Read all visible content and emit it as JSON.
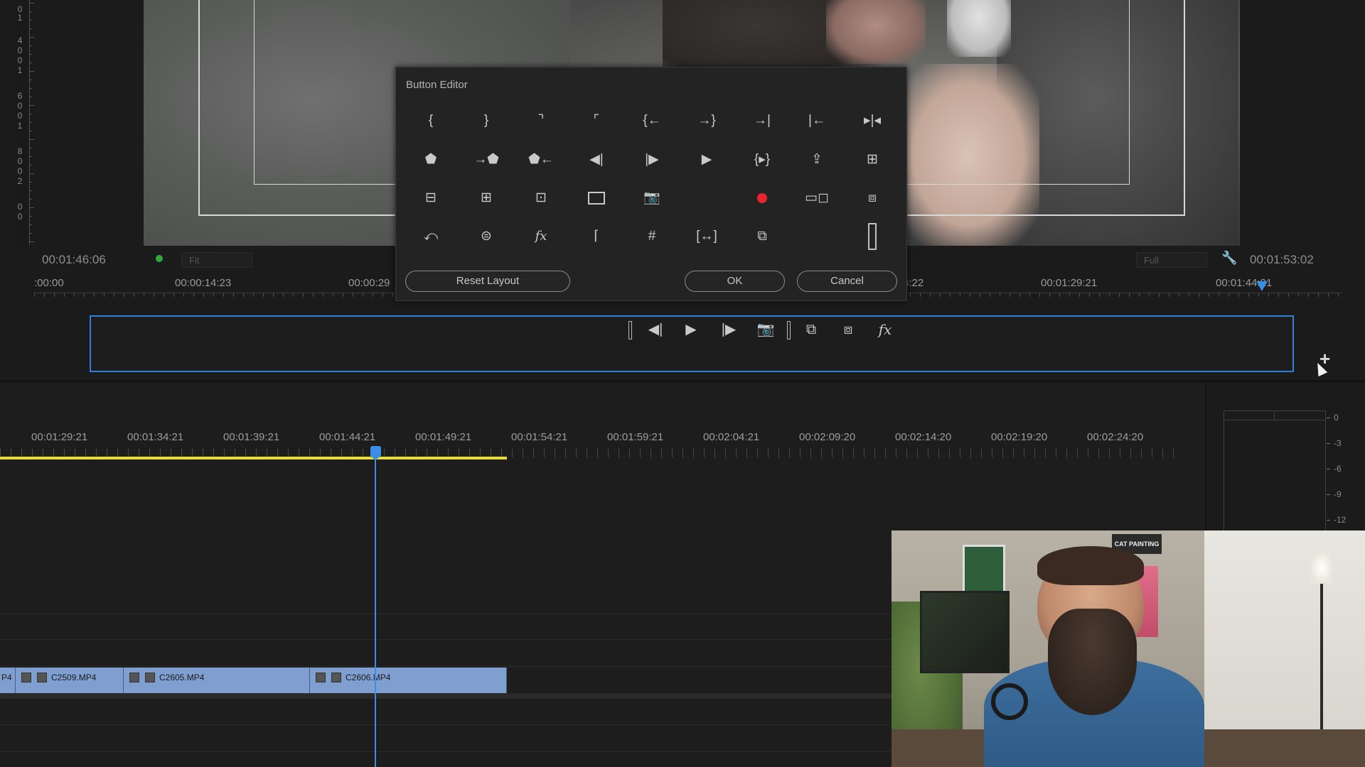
{
  "monitor": {
    "left_ruler_digits": [
      "0",
      "1",
      "4",
      "0",
      "0",
      "1",
      "6",
      "0",
      "0",
      "1",
      "8",
      "0",
      "0",
      "2",
      "0",
      "0"
    ],
    "timecode_current": "00:01:46:06",
    "timecode_duration": "00:01:53:02",
    "fit_select": "Fit",
    "full_select": "Full",
    "ruler_labels": [
      ":00:00",
      "00:00:14:23",
      "00:00:29",
      "4:22",
      "00:01:29:21",
      "00:01:44:21"
    ]
  },
  "button_bar": {
    "buttons": [
      {
        "name": "spacer",
        "glyph": ""
      },
      {
        "name": "step-back-icon",
        "glyph": "◀|"
      },
      {
        "name": "play-icon",
        "glyph": "▶"
      },
      {
        "name": "step-forward-icon",
        "glyph": "|▶"
      },
      {
        "name": "camera-icon",
        "glyph": "📷"
      },
      {
        "name": "spacer",
        "glyph": ""
      },
      {
        "name": "multicam-icon",
        "glyph": "⧉"
      },
      {
        "name": "comparison-view-icon",
        "glyph": "⧈"
      },
      {
        "name": "fx-icon",
        "glyph": "fx"
      }
    ],
    "add_button": "+"
  },
  "dialog": {
    "title": "Button Editor",
    "icons": [
      [
        "{",
        "}",
        "⌝",
        "⌜",
        "{←",
        "→}",
        "→|",
        "|←",
        "▸|◂"
      ],
      [
        "⬟",
        "→⬟",
        "⬟←",
        "◀|",
        "|▶",
        "▶",
        "{▸}",
        "⇪",
        "⊞"
      ],
      [
        "⊟",
        "⊞",
        "⊡",
        "frame",
        "📷",
        "",
        "rec",
        "▭◻",
        "⧈"
      ],
      [
        "⤺",
        "⊜",
        "fx",
        "⌈",
        "#",
        "[↔]",
        "⧉",
        "",
        "spacer"
      ]
    ],
    "reset_label": "Reset Layout",
    "ok_label": "OK",
    "cancel_label": "Cancel"
  },
  "timeline": {
    "ruler_labels": [
      "00:01:29:21",
      "00:01:34:21",
      "00:01:39:21",
      "00:01:44:21",
      "00:01:49:21",
      "00:01:54:21",
      "00:01:59:21",
      "00:02:04:21",
      "00:02:09:20",
      "00:02:14:20",
      "00:02:19:20",
      "00:02:24:20"
    ],
    "clips": [
      {
        "label": "P4"
      },
      {
        "label": "C2509.MP4"
      },
      {
        "label": "C2605.MP4"
      },
      {
        "label": "C2606.MP4"
      }
    ]
  },
  "audio_meter": {
    "db_labels": [
      "0",
      "-3",
      "-6",
      "-9",
      "-12"
    ]
  },
  "webcam": {
    "sign_text": "CAT PAINTING"
  },
  "colors": {
    "accent_blue": "#2f7fd8",
    "record_red": "#e8252f",
    "work_area_yellow": "#e8df2c",
    "clip_blue": "#7f9fd1"
  }
}
